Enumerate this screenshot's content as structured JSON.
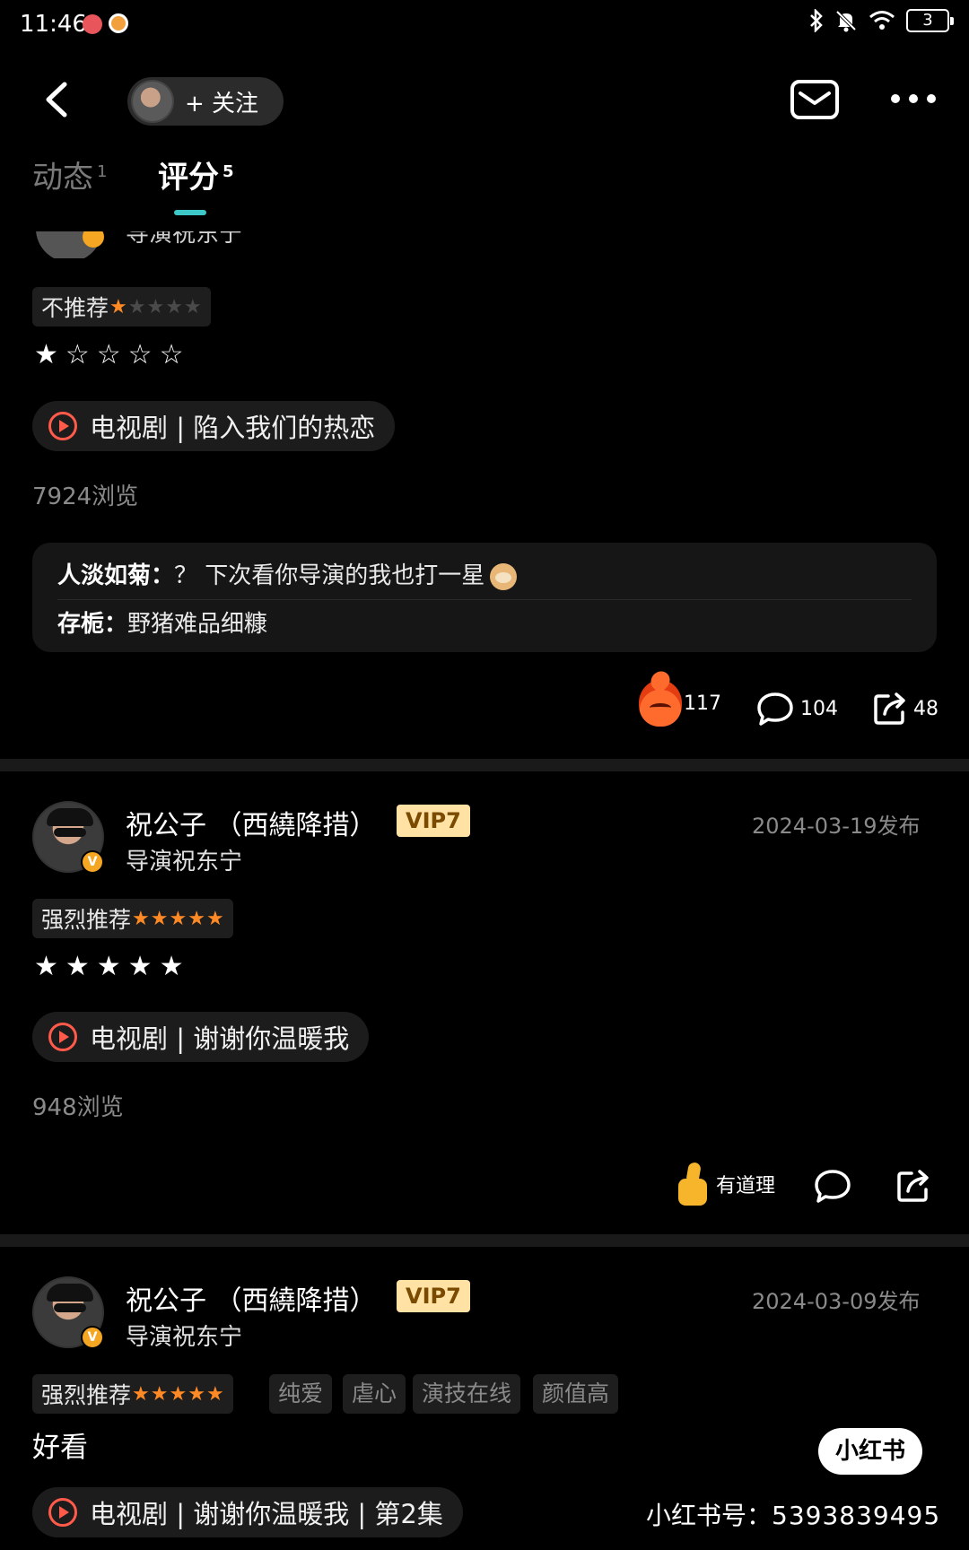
{
  "status": {
    "time": "11:46",
    "battery": "3"
  },
  "header": {
    "follow_label": "+ 关注"
  },
  "tabs": [
    {
      "label": "动态",
      "count": "1"
    },
    {
      "label": "评分",
      "count": "5"
    }
  ],
  "cut_post": {
    "subtitle": "导演祝东宁"
  },
  "post1": {
    "recommendation": "不推荐",
    "star_text": "★☆☆☆☆",
    "media_label": "电视剧 | 陷入我们的热恋",
    "views": "7924浏览",
    "comments": [
      {
        "user": "人淡如菊：",
        "text": "？ 下次看你导演的我也打一星"
      },
      {
        "user": "存栀：",
        "text": "野猪难品细糠"
      }
    ],
    "fire_count": "117",
    "comment_count": "104",
    "share_count": "48"
  },
  "post2": {
    "name": "祝公子 （西繞降措）",
    "vip": "VIP7",
    "subtitle": "导演祝东宁",
    "date": "2024-03-19发布",
    "recommendation": "强烈推荐",
    "star_text": "★★★★★",
    "media_label": "电视剧 | 谢谢你温暖我",
    "views": "948浏览",
    "like_label": "有道理"
  },
  "post3": {
    "name": "祝公子 （西繞降措）",
    "vip": "VIP7",
    "subtitle": "导演祝东宁",
    "date": "2024-03-09发布",
    "recommendation": "强烈推荐",
    "tags": [
      "纯爱",
      "虐心",
      "演技在线",
      "颜值高"
    ],
    "body": "好看",
    "media_label": "电视剧 | 谢谢你温暖我 | 第2集"
  },
  "watermark": {
    "logo": "小红书",
    "id_label": "小红书号：",
    "id_value": "5393839495"
  },
  "colors": {
    "accent_tab": "#3ec7c7",
    "star_orange": "#ff8a25",
    "play_red": "#ff5a4a",
    "vip_bg": "#ffe2a4"
  }
}
